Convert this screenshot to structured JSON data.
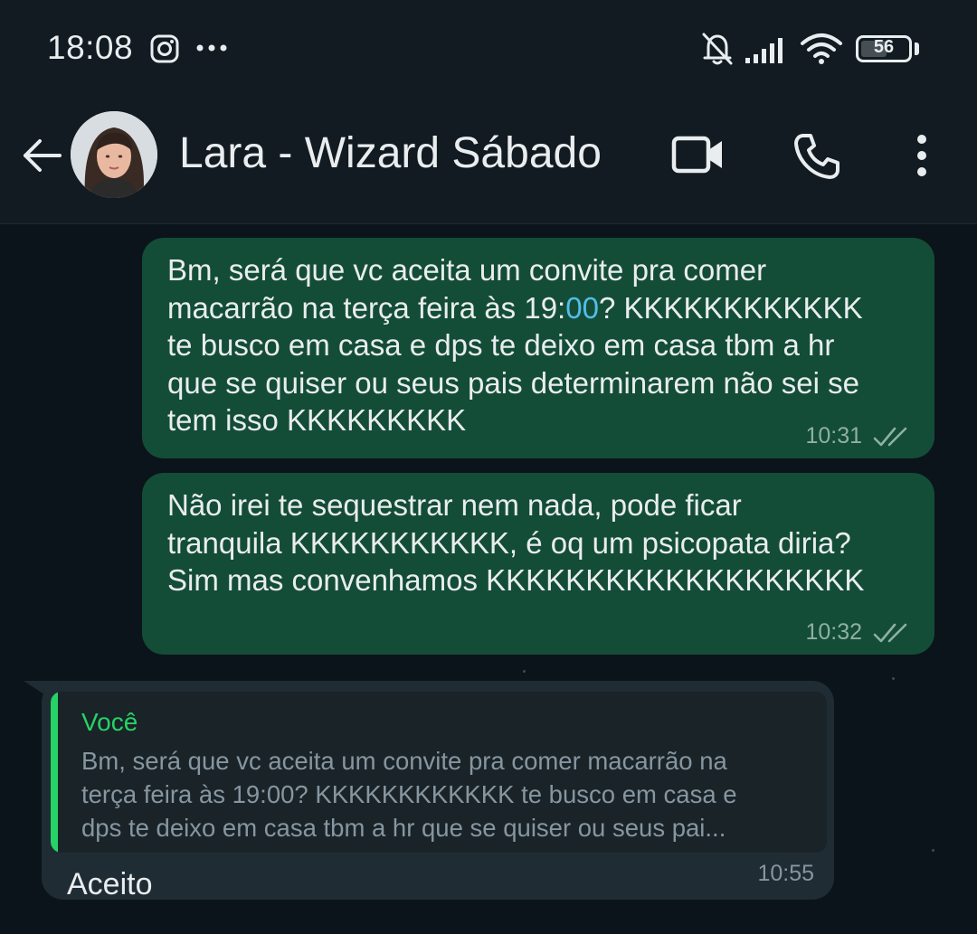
{
  "status_bar": {
    "time": "18:08",
    "battery_level": "56",
    "icons": [
      "instagram-icon",
      "more-notifications-icon",
      "bell-off-icon",
      "signal-icon",
      "wifi-icon",
      "battery-icon"
    ]
  },
  "header": {
    "contact_name": "Lara - Wizard Sábado",
    "icons": [
      "back-arrow-icon",
      "video-call-icon",
      "voice-call-icon",
      "more-vert-icon"
    ]
  },
  "colors": {
    "background": "#0b141a",
    "outgoing_bubble": "#144d37",
    "incoming_bubble": "#202c33",
    "accent": "#25d366",
    "link": "#53bdeb"
  },
  "messages": [
    {
      "direction": "outgoing",
      "text_before": "Bm, será que vc aceita um convite pra comer\nmacarrão na terça feira às 19:",
      "text_highlight": "00",
      "text_after": "? KKKKKKKKKKKK\nte busco em casa e dps te deixo em casa tbm a hr\nque se quiser ou seus pais determinarem não sei se\ntem isso KKKKKKKKK",
      "time": "10:31",
      "status": "read"
    },
    {
      "direction": "outgoing",
      "text": "Não irei te sequestrar nem nada, pode ficar\ntranquila KKKKKKKKKKK, é oq um psicopata diria?\nSim mas convenhamos KKKKKKKKKKKKKKKKKKK",
      "time": "10:32",
      "status": "read"
    },
    {
      "direction": "incoming",
      "quote_author": "Você",
      "quote_text": "Bm, será que vc aceita um convite pra comer macarrão na\nterça feira às 19:00? KKKKKKKKKKKK te busco em casa e\ndps te deixo em casa tbm a hr que se quiser ou seus pai...",
      "text": "Aceito",
      "time": "10:55"
    }
  ]
}
